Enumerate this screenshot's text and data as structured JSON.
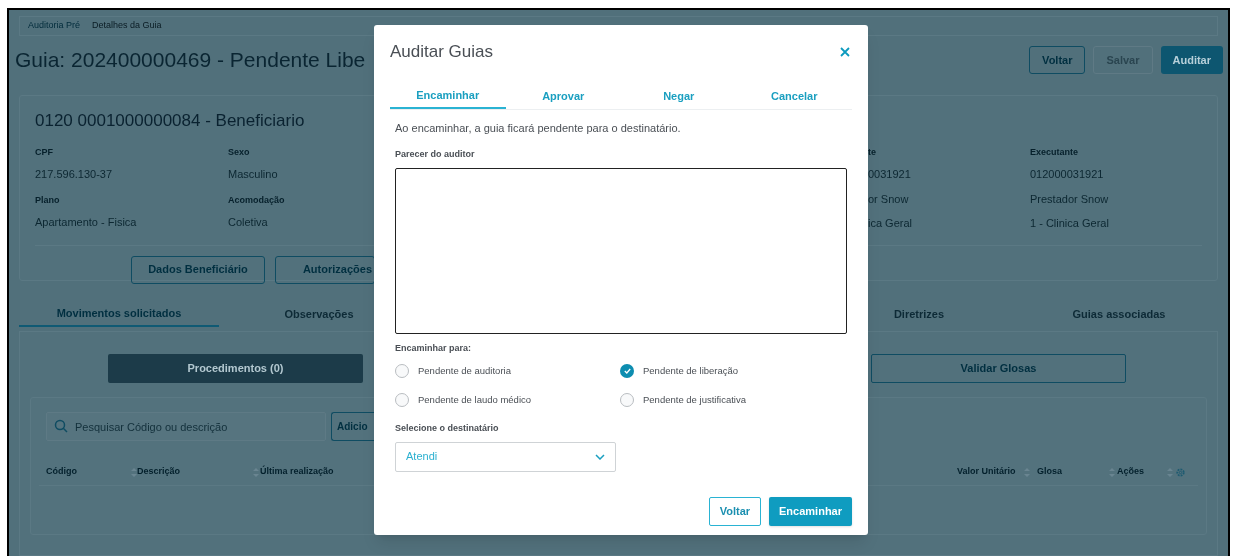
{
  "breadcrumb": [
    "Auditoria Pré",
    "Detalhes da Guia"
  ],
  "page_title": "Guia: 202400000469 - Pendente Libe",
  "header_buttons": [
    {
      "label": "Voltar",
      "kind": "outline",
      "disabled": false
    },
    {
      "label": "Salvar",
      "kind": "outline",
      "disabled": true
    },
    {
      "label": "Auditar",
      "kind": "primary",
      "disabled": false
    }
  ],
  "beneficiary": {
    "title": "0120 0001000000084 - Beneficiario",
    "columns": [
      [
        {
          "kind": "label",
          "text": "CPF"
        },
        {
          "kind": "value",
          "text": "217.596.130-37"
        },
        {
          "kind": "label",
          "text": "Plano"
        },
        {
          "kind": "value",
          "text": "Apartamento - Fisica"
        }
      ],
      [
        {
          "kind": "label",
          "text": "Sexo"
        },
        {
          "kind": "value",
          "text": "Masculino"
        },
        {
          "kind": "label",
          "text": "Acomodação"
        },
        {
          "kind": "value",
          "text": "Coletiva"
        }
      ],
      [
        {
          "kind": "label",
          "text": "te"
        },
        {
          "kind": "value",
          "text": "0031921"
        },
        {
          "kind": "value",
          "text": "or Snow"
        },
        {
          "kind": "value",
          "text": "ica Geral"
        }
      ],
      [
        {
          "kind": "label",
          "text": "Executante"
        },
        {
          "kind": "value",
          "text": "012000031921"
        },
        {
          "kind": "value",
          "text": "Prestador Snow"
        },
        {
          "kind": "value",
          "text": "1 - Clinica Geral"
        }
      ]
    ],
    "buttons": [
      "Dados Beneficiário",
      "Autorizações"
    ]
  },
  "tabs": [
    {
      "label": "Movimentos solicitados",
      "selected": true
    },
    {
      "label": "Observações",
      "selected": false
    },
    {
      "label": "Diretrizes",
      "selected": false
    },
    {
      "label": "Guias associadas",
      "selected": false
    }
  ],
  "segments": [
    {
      "label": "Procedimentos (0)",
      "selected": true
    },
    {
      "label": "Validar Glosas",
      "selected": false
    }
  ],
  "search": {
    "placeholder": "Pesquisar Código ou descrição"
  },
  "add_button": "Adicio",
  "table": {
    "columns": [
      "Código",
      "Descrição",
      "Última realização",
      "Valor Unitário",
      "Glosa",
      "Ações"
    ]
  },
  "modal": {
    "title": "Auditar Guias",
    "tabs": [
      {
        "label": "Encaminhar",
        "selected": true
      },
      {
        "label": "Aprovar",
        "selected": false
      },
      {
        "label": "Negar",
        "selected": false
      },
      {
        "label": "Cancelar",
        "selected": false
      }
    ],
    "info": "Ao encaminhar, a guia ficará pendente para o destinatário.",
    "opinion_label": "Parecer do auditor",
    "forward_label": "Encaminhar para:",
    "options": [
      {
        "label": "Pendente de auditoria",
        "selected": false
      },
      {
        "label": "Pendente de liberação",
        "selected": true
      },
      {
        "label": "Pendente de laudo médico",
        "selected": false
      },
      {
        "label": "Pendente de justificativa",
        "selected": false
      }
    ],
    "recipient_label": "Selecione o destinatário",
    "recipient": {
      "value": "Atendi"
    },
    "buttons": [
      {
        "label": "Voltar",
        "kind": "outline"
      },
      {
        "label": "Encaminhar",
        "kind": "primary"
      }
    ]
  }
}
